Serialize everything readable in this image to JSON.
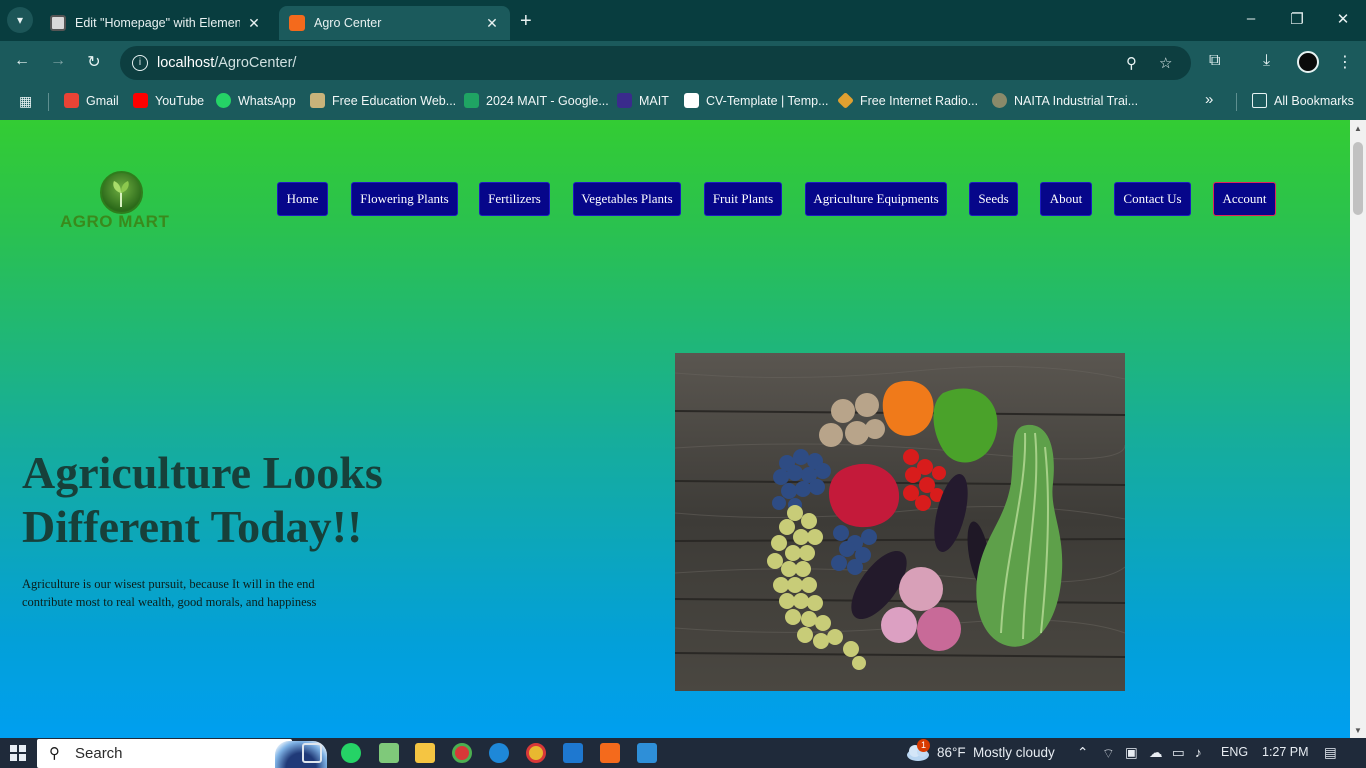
{
  "browser": {
    "tabs": [
      {
        "title": "Edit \"Homepage\" with Elementor"
      },
      {
        "title": "Agro Center"
      }
    ],
    "url_host": "localhost",
    "url_path": "/AgroCenter/",
    "bookmarks": [
      {
        "label": "Gmail",
        "color": "#ea4335"
      },
      {
        "label": "YouTube",
        "color": "#ff0000"
      },
      {
        "label": "WhatsApp",
        "color": "#25d366"
      },
      {
        "label": "Free Education Web...",
        "color": "#c9b37a"
      },
      {
        "label": "2024 MAIT - Google...",
        "color": "#1fa463"
      },
      {
        "label": "MAIT",
        "color": "#3a2b8c"
      },
      {
        "label": "CV-Template | Temp...",
        "color": "#ffffff"
      },
      {
        "label": "Free Internet Radio...",
        "color": "#e0a030"
      },
      {
        "label": "NAITA Industrial Trai...",
        "color": "#8a8a6a"
      }
    ],
    "all_bookmarks": "All Bookmarks"
  },
  "site": {
    "logo_text": "AGRO MART",
    "nav": [
      "Home",
      "Flowering Plants",
      "Fertilizers",
      "Vegetables Plants",
      "Fruit Plants",
      "Agriculture Equipments",
      "Seeds",
      "About",
      "Contact Us",
      "Account"
    ],
    "hero": {
      "title": "Agriculture Looks Different Today!!",
      "text": "Agriculture is our wisest pursuit, because It will in the end contribute most to real wealth, good morals, and happiness"
    }
  },
  "taskbar": {
    "search": "Search",
    "weather_temp": "86°F",
    "weather_desc": "Mostly cloudy",
    "weather_badge": "1",
    "language": "ENG",
    "time": "1:27 PM"
  },
  "colors": {
    "nav_button": "#06068a",
    "page_gradient_top": "#33cc33",
    "page_gradient_bottom": "#009ff0",
    "hero_title": "#17403a"
  }
}
